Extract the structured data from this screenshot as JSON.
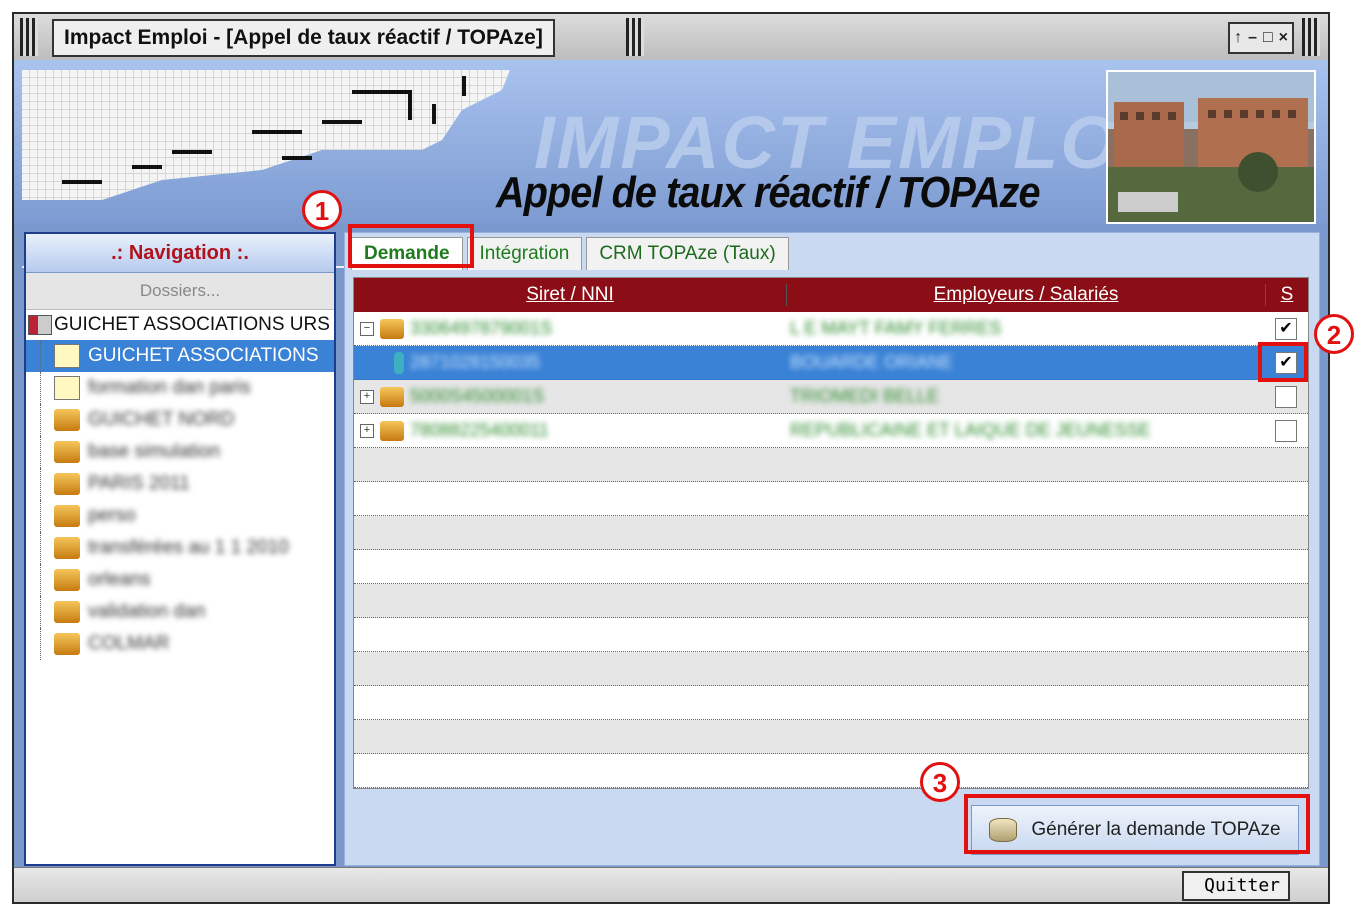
{
  "window": {
    "title": "Impact Emploi - [Appel de taux réactif / TOPAze]",
    "controls": [
      "↑",
      "–",
      "□",
      "×"
    ]
  },
  "header": {
    "brand": "IMPACT EMPLOI",
    "subtitle": "Appel de taux réactif / TOPAze"
  },
  "nav": {
    "title": ".: Navigation :.",
    "section": "Dossiers...",
    "root": "GUICHET ASSOCIATIONS URS",
    "items": [
      {
        "label": "GUICHET ASSOCIATIONS",
        "icon": "document-icon",
        "selected": true
      },
      {
        "label": "formation dan paris",
        "icon": "document-icon",
        "blurred": true
      },
      {
        "label": "GUICHET NORD",
        "icon": "folder-icon",
        "blurred": true
      },
      {
        "label": "base simulation",
        "icon": "folder-icon",
        "blurred": true
      },
      {
        "label": "PARIS 2011",
        "icon": "folder-icon",
        "blurred": true
      },
      {
        "label": "perso",
        "icon": "folder-icon",
        "blurred": true
      },
      {
        "label": "transférées au 1 1 2010",
        "icon": "folder-icon",
        "blurred": true
      },
      {
        "label": "orleans",
        "icon": "folder-icon",
        "blurred": true
      },
      {
        "label": "validation dan",
        "icon": "folder-icon",
        "blurred": true
      },
      {
        "label": "COLMAR",
        "icon": "folder-icon",
        "blurred": true
      }
    ]
  },
  "tabs": [
    "Demande",
    "Intégration",
    "CRM TOPAze (Taux)"
  ],
  "grid": {
    "headers": [
      "Siret / NNI",
      "Employeurs / Salariés",
      "S"
    ],
    "rows": [
      {
        "siret": "3306497879001S",
        "employer": "L E MAYT FAMY FERRES",
        "checked": true,
        "expander": "−",
        "blurred": true
      },
      {
        "siret": "2871028150035",
        "employer": "BOUARDE ORIANE",
        "checked": true,
        "expander": "",
        "blurred": true,
        "selected": true
      },
      {
        "siret": "5000S4500001S",
        "employer": "TRIOMEDI BELLE",
        "checked": false,
        "expander": "+",
        "blurred": true
      },
      {
        "siret": "78088225400011",
        "employer": "REPUBLICAINE ET LAIQUE DE JEUNESSE",
        "checked": false,
        "expander": "+",
        "blurred": true
      }
    ]
  },
  "generate_button": "Générer la demande TOPAze",
  "footer": {
    "quit_button": "Quitter"
  },
  "annotations": [
    "1",
    "2",
    "3"
  ],
  "colors": {
    "accent_red": "#e31010",
    "grid_header": "#8b0e16",
    "selection": "#3a82d6",
    "frame_blue": "#7a98cc"
  }
}
